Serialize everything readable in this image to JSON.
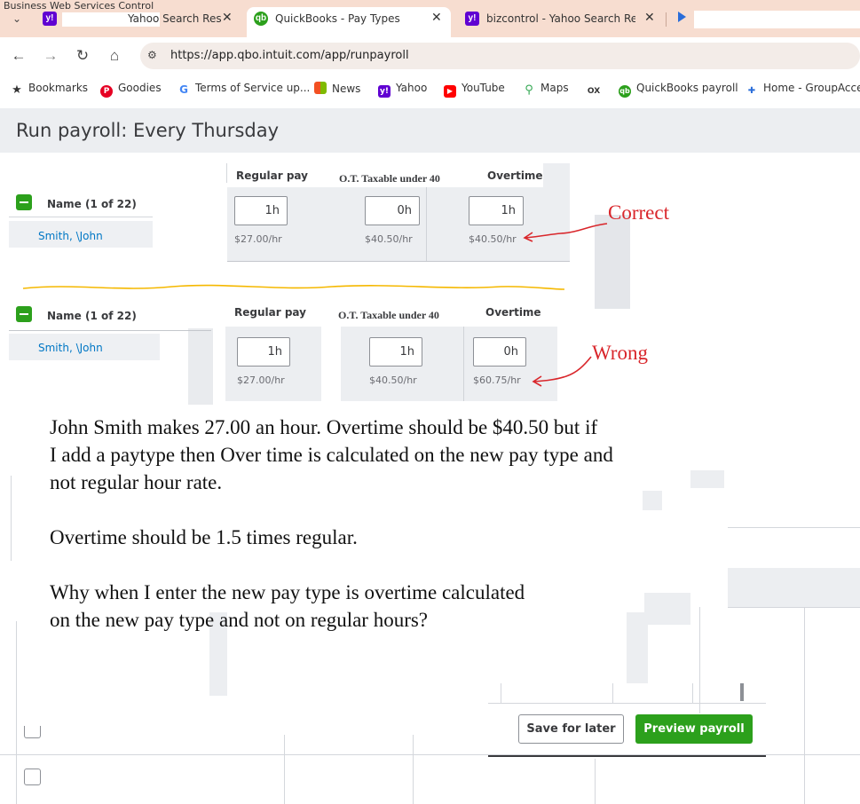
{
  "browser": {
    "window_title": "Business Web Services Control",
    "tabs": [
      {
        "label": "Yahoo Search Res",
        "favicon": "yahoo-icon",
        "active": false
      },
      {
        "label": "QuickBooks - Pay Types",
        "favicon": "quickbooks-icon",
        "active": true
      },
      {
        "label": "bizcontrol - Yahoo Search Resul",
        "favicon": "yahoo-icon",
        "active": false
      }
    ],
    "url": "https://app.qbo.intuit.com/app/runpayroll",
    "bookmarks": [
      {
        "label": "Bookmarks",
        "icon": "star-icon"
      },
      {
        "label": "Goodies",
        "icon": "pinterest-icon"
      },
      {
        "label": "Terms of Service up...",
        "icon": "google-icon"
      },
      {
        "label": "News",
        "icon": "microsoft-icon"
      },
      {
        "label": "Yahoo",
        "icon": "yahoo-icon"
      },
      {
        "label": "YouTube",
        "icon": "youtube-icon"
      },
      {
        "label": "Maps",
        "icon": "maps-pin-icon"
      },
      {
        "label": "",
        "icon": "ox-icon"
      },
      {
        "label": "QuickBooks payroll",
        "icon": "quickbooks-icon"
      },
      {
        "label": "Home - GroupAcces",
        "icon": "groupaccess-icon"
      }
    ]
  },
  "page": {
    "title": "Run payroll: Every Thursday"
  },
  "grids": [
    {
      "name_header": "Name (1 of 22)",
      "employee": "Smith, \\John",
      "columns": [
        {
          "header": "Regular pay",
          "hours": "1h",
          "rate": "$27.00/hr"
        },
        {
          "header": "O.T. Taxable under 40",
          "hours": "0h",
          "rate": "$40.50/hr"
        },
        {
          "header": "Overtime",
          "hours": "1h",
          "rate": "$40.50/hr"
        }
      ],
      "annotation": "Correct"
    },
    {
      "name_header": "Name (1 of 22)",
      "employee": "Smith, \\John",
      "columns": [
        {
          "header": "Regular pay",
          "hours": "1h",
          "rate": "$27.00/hr"
        },
        {
          "header": "O.T. Taxable under 40",
          "hours": "1h",
          "rate": "$40.50/hr"
        },
        {
          "header": "Overtime",
          "hours": "0h",
          "rate": "$60.75/hr"
        }
      ],
      "annotation": "Wrong"
    }
  ],
  "note": {
    "lines": [
      "John Smith makes 27.00 an hour.  Overtime should be $40.50 but if",
      "I add a paytype then Over time is calculated on the new pay type and",
      "not regular hour rate.",
      "Overtime should be 1.5 times regular.",
      "Why when I enter the new pay type is overtime calculated",
      "on the new pay type and not on regular hours?"
    ]
  },
  "footer": {
    "save_label": "Save for later",
    "preview_label": "Preview payroll"
  },
  "colors": {
    "qb_green": "#2ca01c",
    "link_blue": "#0077c5",
    "annotation_red": "#d9262b",
    "divider_yellow": "#f5b800",
    "tab_strip": "#f7ddd0"
  }
}
